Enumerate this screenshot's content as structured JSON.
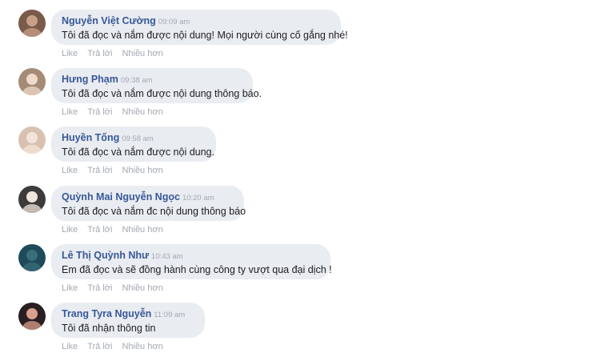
{
  "comments": [
    {
      "author": "Nguyễn Việt Cường",
      "time": "09:09 am",
      "text": "Tôi đã đọc và nắm được nội dung! Mọi người cùng cố gắng nhé!",
      "avatar_icon": "avatar-user-photo",
      "avatar_colors": [
        "#7a5a4a",
        "#c8a08a"
      ]
    },
    {
      "author": "Hưng Phạm",
      "time": "09:38 am",
      "text": "Tôi đã đọc và nắm được nội dung thông báo.",
      "avatar_icon": "avatar-user-photo",
      "avatar_colors": [
        "#a58b76",
        "#efd9c8"
      ]
    },
    {
      "author": "Huyền Tống",
      "time": "09:58 am",
      "text": "Tôi đã đọc và nắm được nội dung.",
      "avatar_icon": "avatar-user-photo",
      "avatar_colors": [
        "#d8c1b1",
        "#f4e4d8"
      ]
    },
    {
      "author": "Quỳnh Mai Nguyễn Ngọc",
      "time": "10:20 am",
      "text": "Tôi đã đọc và nắm đc nội dung thông báo",
      "avatar_icon": "avatar-user-photo",
      "avatar_colors": [
        "#3c3a3a",
        "#f0e6dc"
      ]
    },
    {
      "author": "Lê Thị Quỳnh Như",
      "time": "10:43 am",
      "text": "Em đã đọc và sẽ đồng hành cùng công ty vượt qua đại dịch !",
      "avatar_icon": "avatar-user-photo",
      "avatar_colors": [
        "#1e4a5a",
        "#3a6f7a"
      ]
    },
    {
      "author": "Trang Tyra Nguyễn",
      "time": "11:09 am",
      "text": "Tôi  đã nhận thông tin",
      "avatar_icon": "avatar-user-photo",
      "avatar_colors": [
        "#2a1e22",
        "#d9a08c"
      ]
    }
  ],
  "actions": {
    "like": "Like",
    "reply": "Trả lời",
    "more": "Nhiều hơn"
  },
  "colors": {
    "author": "#385898",
    "bubble": "#e9ecf0",
    "meta": "#a3a8b0",
    "text": "#1c1e21"
  }
}
